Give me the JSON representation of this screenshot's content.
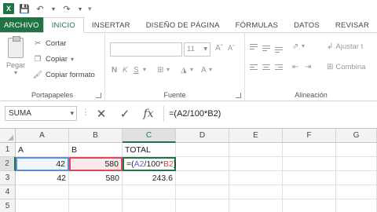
{
  "qat": {
    "logo_text": "X",
    "save_icon": "save-icon",
    "undo_icon": "undo-icon",
    "redo_icon": "redo-icon"
  },
  "tabs": [
    "ARCHIVO",
    "INICIO",
    "INSERTAR",
    "DISEÑO DE PÁGINA",
    "FÓRMULAS",
    "DATOS",
    "REVISAR"
  ],
  "active_tab": "INICIO",
  "ribbon": {
    "clipboard": {
      "paste_label": "Pegar",
      "cut_label": "Cortar",
      "copy_label": "Copiar",
      "format_painter_label": "Copiar formato",
      "group_label": "Portapapeles"
    },
    "font": {
      "font_size": "11",
      "bold": "N",
      "italic": "K",
      "underline": "S",
      "group_label": "Fuente"
    },
    "alignment": {
      "wrap_label": "Ajustar t",
      "merge_label": "Combina",
      "group_label": "Alineación"
    }
  },
  "formula_bar": {
    "name_box": "SUMA",
    "formula": "=(A2/100*B2)"
  },
  "columns": [
    "A",
    "B",
    "C",
    "D",
    "E",
    "F",
    "G"
  ],
  "selected_column": "C",
  "rows": [
    "1",
    "2",
    "3",
    "4",
    "5"
  ],
  "selected_row": "2",
  "cells": {
    "A1": "A",
    "B1": "B",
    "C1": "TOTAL",
    "A2": "42",
    "B2": "580",
    "A3": "42",
    "B3": "580",
    "C3": "243.6"
  },
  "edit_cell": {
    "prefix": "=(",
    "ref_a": "A2",
    "mid": "/100*",
    "ref_b": "B2",
    "suffix": ")"
  },
  "colors": {
    "accent": "#217346",
    "ref_a": "#4472c4",
    "ref_b": "#c0504d"
  }
}
